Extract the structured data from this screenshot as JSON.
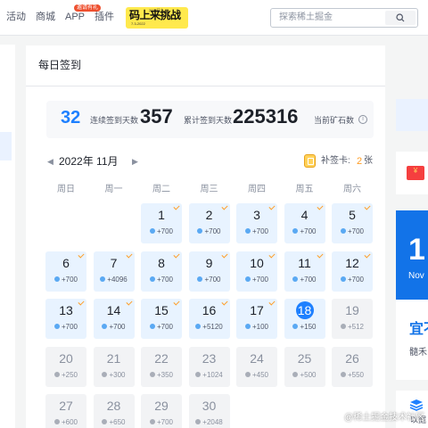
{
  "nav": {
    "items": [
      "活动",
      "商城",
      "APP",
      "插件"
    ],
    "app_badge": "邀请有礼",
    "banner": {
      "main": "码上来挑战",
      "sub": "7.3-2022",
      "tiny": "2022码上"
    },
    "search_placeholder": "探索稀土掘金"
  },
  "card": {
    "title": "每日签到",
    "stats": {
      "streak": "32",
      "streak_label": "连续签到天数",
      "total": "357",
      "total_label": "累计签到天数",
      "ore": "225316",
      "ore_label": "当前矿石数"
    },
    "month": "2022年 11月",
    "prev_arrow": "◀",
    "next_arrow": "▶",
    "retro_label": "补签卡:",
    "retro_count": "2",
    "retro_unit": "张",
    "weekdays": [
      "周日",
      "周一",
      "周二",
      "周三",
      "周四",
      "周五",
      "周六"
    ],
    "days": [
      {
        "day": "1",
        "pts": "+700",
        "state": "signed"
      },
      {
        "day": "2",
        "pts": "+700",
        "state": "signed"
      },
      {
        "day": "3",
        "pts": "+700",
        "state": "signed"
      },
      {
        "day": "4",
        "pts": "+700",
        "state": "signed"
      },
      {
        "day": "5",
        "pts": "+700",
        "state": "signed"
      },
      {
        "day": "6",
        "pts": "+700",
        "state": "signed"
      },
      {
        "day": "7",
        "pts": "+4096",
        "state": "signed"
      },
      {
        "day": "8",
        "pts": "+700",
        "state": "signed"
      },
      {
        "day": "9",
        "pts": "+700",
        "state": "signed"
      },
      {
        "day": "10",
        "pts": "+700",
        "state": "signed"
      },
      {
        "day": "11",
        "pts": "+700",
        "state": "signed"
      },
      {
        "day": "12",
        "pts": "+700",
        "state": "signed"
      },
      {
        "day": "13",
        "pts": "+700",
        "state": "signed"
      },
      {
        "day": "14",
        "pts": "+700",
        "state": "signed"
      },
      {
        "day": "15",
        "pts": "+700",
        "state": "signed"
      },
      {
        "day": "16",
        "pts": "+5120",
        "state": "signed"
      },
      {
        "day": "17",
        "pts": "+100",
        "state": "signed"
      },
      {
        "day": "18",
        "pts": "+150",
        "state": "today"
      },
      {
        "day": "19",
        "pts": "+512",
        "state": "future"
      },
      {
        "day": "20",
        "pts": "+250",
        "state": "future"
      },
      {
        "day": "21",
        "pts": "+300",
        "state": "future"
      },
      {
        "day": "22",
        "pts": "+350",
        "state": "future"
      },
      {
        "day": "23",
        "pts": "+1024",
        "state": "future"
      },
      {
        "day": "24",
        "pts": "+450",
        "state": "future"
      },
      {
        "day": "25",
        "pts": "+500",
        "state": "future"
      },
      {
        "day": "26",
        "pts": "+550",
        "state": "future"
      },
      {
        "day": "27",
        "pts": "+600",
        "state": "future"
      },
      {
        "day": "28",
        "pts": "+650",
        "state": "future"
      },
      {
        "day": "29",
        "pts": "+700",
        "state": "future"
      },
      {
        "day": "30",
        "pts": "+2048",
        "state": "future"
      }
    ]
  },
  "right": {
    "envelope_glyph": "¥",
    "banner_big": "1",
    "banner_small": "Nov",
    "ad_title": "宜不",
    "ad_sub": "髓禾",
    "c_text": "以掘"
  },
  "watermark": "@稀土掘金技术社区",
  "colors": {
    "accent": "#1e80ff",
    "check": "#ff9c24",
    "signed_bg": "#e8f3ff",
    "future_bg": "#f2f3f5"
  }
}
